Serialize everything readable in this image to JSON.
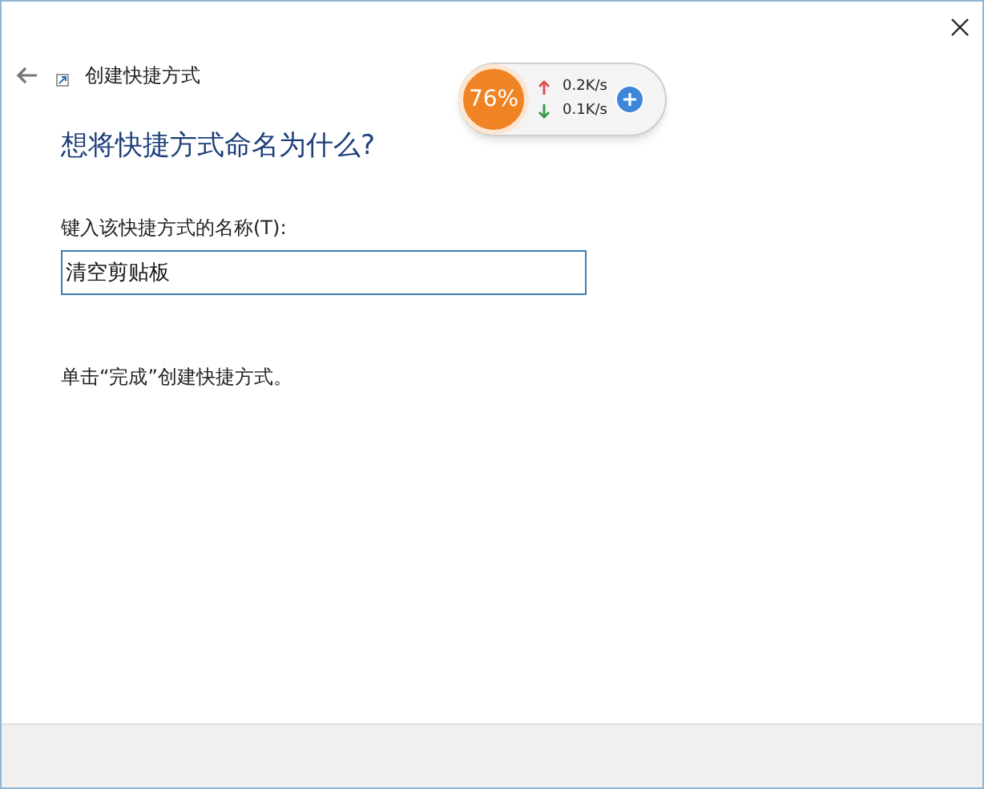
{
  "window": {
    "title": "创建快捷方式"
  },
  "heading": "想将快捷方式命名为什么?",
  "name_field": {
    "label": "键入该快捷方式的名称(T):",
    "value": "清空剪贴板"
  },
  "hint": "单击“完成”创建快捷方式。",
  "speed_widget": {
    "percent": "76%",
    "upload": "0.2K/s",
    "download": "0.1K/s"
  }
}
